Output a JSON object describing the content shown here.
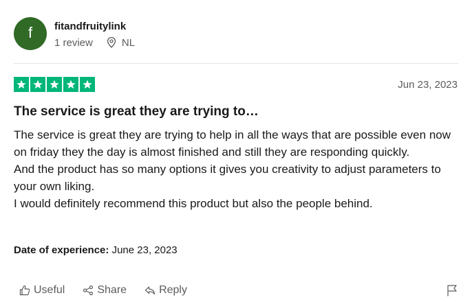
{
  "reviewer": {
    "avatar_initial": "f",
    "avatar_color": "#306a26",
    "name": "fitandfruitylink",
    "review_count": "1 review",
    "location_icon": "location-pin-icon",
    "location": "NL"
  },
  "review": {
    "rating": 5,
    "star_color": "#00b67a",
    "date": "Jun 23, 2023",
    "title": "The service is great they are trying to…",
    "paragraphs": [
      "The service is great they are trying to help in all the ways that are possible even now on friday they the day is almost finished and still they are responding quickly.",
      "And the product has so many options it gives you creativity to adjust parameters to your own liking.",
      "I would definitely recommend this product but also the people behind."
    ],
    "experience_label": "Date of experience:",
    "experience_date": "June 23, 2023"
  },
  "actions": {
    "useful": "Useful",
    "share": "Share",
    "reply": "Reply",
    "report_icon": "flag-icon"
  }
}
